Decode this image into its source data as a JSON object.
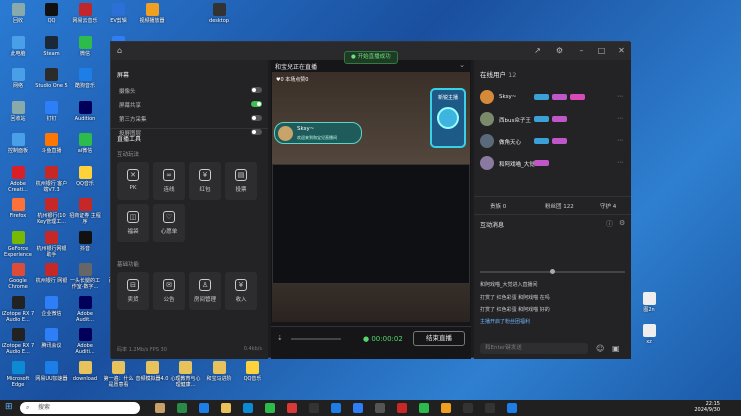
{
  "desktop": {
    "icons": [
      {
        "label": "回收",
        "col": 0,
        "row": 0,
        "color": "#8aa"
      },
      {
        "label": "QQ",
        "col": 1,
        "row": 0,
        "color": "#111"
      },
      {
        "label": "网易云音乐",
        "col": 2,
        "row": 0,
        "color": "#c0272d"
      },
      {
        "label": "EV剪辑",
        "col": 3,
        "row": 0,
        "color": "#2c6fd6"
      },
      {
        "label": "视频播放器",
        "col": 4,
        "row": 0,
        "color": "#f0a020"
      },
      {
        "label": "desktop",
        "col": 6,
        "row": 0,
        "color": "#333"
      },
      {
        "label": "此电脑",
        "col": 0,
        "row": 1,
        "color": "#4aa0e8"
      },
      {
        "label": "Steam",
        "col": 1,
        "row": 1,
        "color": "#1b2838"
      },
      {
        "label": "微信",
        "col": 2,
        "row": 1,
        "color": "#2dbb4c"
      },
      {
        "label": "钉钉",
        "col": 3,
        "row": 1,
        "color": "#2d7ef7"
      },
      {
        "label": "网络",
        "col": 0,
        "row": 2,
        "color": "#4aa0e8"
      },
      {
        "label": "Studio One 5",
        "col": 1,
        "row": 2,
        "color": "#2b2b2b"
      },
      {
        "label": "酷狗音乐",
        "col": 2,
        "row": 2,
        "color": "#1e7ee8"
      },
      {
        "label": "回收站",
        "col": 0,
        "row": 3,
        "color": "#8aa"
      },
      {
        "label": "钉钉",
        "col": 1,
        "row": 3,
        "color": "#2d7ef7"
      },
      {
        "label": "Audition",
        "col": 2,
        "row": 3,
        "color": "#00005b"
      },
      {
        "label": "控制面板",
        "col": 0,
        "row": 4,
        "color": "#4aa0e8"
      },
      {
        "label": "斗鱼直播",
        "col": 1,
        "row": 4,
        "color": "#ff7700"
      },
      {
        "label": "ai微信",
        "col": 2,
        "row": 4,
        "color": "#2dbb4c"
      },
      {
        "label": "Adobe Creati...",
        "col": 0,
        "row": 5,
        "color": "#da1f26"
      },
      {
        "label": "杭州银行 客户端V7.3",
        "col": 1,
        "row": 5,
        "color": "#c62828"
      },
      {
        "label": "QQ音乐",
        "col": 2,
        "row": 5,
        "color": "#ffd23c"
      },
      {
        "label": "WPS",
        "col": 3,
        "row": 5,
        "color": "#c62828"
      },
      {
        "label": "Firefox",
        "col": 0,
        "row": 6,
        "color": "#ff7139"
      },
      {
        "label": "杭州银行(10 Key管理工...",
        "col": 1,
        "row": 6,
        "color": "#c62828"
      },
      {
        "label": "招商证券 主程序",
        "col": 2,
        "row": 6,
        "color": "#c62828"
      },
      {
        "label": "迅雷",
        "col": 3,
        "row": 6,
        "color": "#1e7ee8"
      },
      {
        "label": "GeForce Experience",
        "col": 0,
        "row": 7,
        "color": "#76b900"
      },
      {
        "label": "杭州银行网银助手",
        "col": 1,
        "row": 7,
        "color": "#c62828"
      },
      {
        "label": "抖音",
        "col": 2,
        "row": 7,
        "color": "#111"
      },
      {
        "label": "Google Chrome",
        "col": 0,
        "row": 8,
        "color": "#dd4b39"
      },
      {
        "label": "杭州银行 网银",
        "col": 1,
        "row": 8,
        "color": "#c62828"
      },
      {
        "label": "一头长腿的工作室-数字...",
        "col": 2,
        "row": 8,
        "color": "#666"
      },
      {
        "label": "百度网盘",
        "col": 3,
        "row": 8,
        "color": "#2d7ef7"
      },
      {
        "label": "iZotope RX 7 Audio E...",
        "col": 0,
        "row": 9,
        "color": "#222"
      },
      {
        "label": "企业微信",
        "col": 1,
        "row": 9,
        "color": "#2d7ef7"
      },
      {
        "label": "Adobe Audit...",
        "col": 2,
        "row": 9,
        "color": "#00005b"
      },
      {
        "label": "iZotope RX 7 Audio E...",
        "col": 0,
        "row": 10,
        "color": "#222"
      },
      {
        "label": "腾讯会议",
        "col": 1,
        "row": 10,
        "color": "#2d7ef7"
      },
      {
        "label": "Adobe Auditi...",
        "col": 2,
        "row": 10,
        "color": "#00005b"
      },
      {
        "label": "Microsoft Edge",
        "col": 0,
        "row": 11,
        "color": "#0c8ad4"
      },
      {
        "label": "网易UU加速器",
        "col": 1,
        "row": 11,
        "color": "#1e7ee8"
      },
      {
        "label": "download",
        "col": 2,
        "row": 11,
        "color": "#e8c25a"
      },
      {
        "label": "第一遍：什么是愿意看",
        "col": 3,
        "row": 11,
        "color": "#e8c25a"
      },
      {
        "label": "音频模拟器4.0",
        "col": 4,
        "row": 11,
        "color": "#e8c25a"
      },
      {
        "label": "心理教育与心理健康...",
        "col": 5,
        "row": 11,
        "color": "#e8c25a"
      },
      {
        "label": "和宝马进阶",
        "col": 6,
        "row": 11,
        "color": "#e8c25a"
      },
      {
        "label": "QQ音乐",
        "col": 7,
        "row": 11,
        "color": "#ffd23c"
      }
    ],
    "right_icons": [
      {
        "label": "图2n",
        "row": 0
      },
      {
        "label": "xz",
        "row": 1
      }
    ]
  },
  "app": {
    "badge": "开始直播成功",
    "center_title": "和宝兒正在直播",
    "online_title": "在线用户",
    "online_count": "12",
    "left": {
      "screen_title": "屏幕",
      "toggles": [
        {
          "label": "摄像头",
          "on": false
        },
        {
          "label": "屏幕共享",
          "on": true
        },
        {
          "label": "第三方采集",
          "on": false
        },
        {
          "label": "投屏图层",
          "on": false
        }
      ],
      "tools_title": "直播工具",
      "interact_title": "互动玩法",
      "interact_tiles": [
        {
          "label": "PK",
          "icon": "✕"
        },
        {
          "label": "连线",
          "icon": "∞"
        },
        {
          "label": "红包",
          "icon": "¥"
        },
        {
          "label": "投票",
          "icon": "▤"
        },
        {
          "label": "福袋",
          "icon": "◫"
        },
        {
          "label": "心愿单",
          "icon": "♡"
        }
      ],
      "basic_title": "基础功能",
      "basic_tiles": [
        {
          "label": "卖货",
          "icon": "⊟"
        },
        {
          "label": "公告",
          "icon": "✉"
        },
        {
          "label": "房间管理",
          "icon": "♙"
        },
        {
          "label": "收入",
          "icon": "¥"
        }
      ],
      "status_left": "码率 1.2Mb/s FPS 30",
      "status_right": "0.4kb/s"
    },
    "center": {
      "stats": "♥0 本场点赞0",
      "streamer_name": "Sksy~",
      "streamer_sub": "欢迎来到和宝兒直播间",
      "timer": "00:00:02",
      "end_button": "结束直播",
      "banner": "新锐主播"
    },
    "right": {
      "users": [
        {
          "name": "Sksy~",
          "color": "#d58a3a",
          "tags": [
            "#3aa0d8",
            "#c057c8",
            "#d84ab8"
          ]
        },
        {
          "name": "西bus众子王",
          "color": "#7a8a6a",
          "tags": [
            "#3aa0d8",
            "#c057c8"
          ]
        },
        {
          "name": "做角天心",
          "color": "#5a6a7a",
          "tags": [
            "#3aa0d8",
            "#c057c8"
          ]
        },
        {
          "name": "和阿戏喵_大觉",
          "color": "#8a7aa0",
          "tags": [
            "#c057c8"
          ]
        }
      ],
      "stats": [
        {
          "label": "贵族 0"
        },
        {
          "label": "粉丝团 122"
        },
        {
          "label": "守护 4"
        }
      ],
      "messages_title": "互动消息",
      "system_msg": "和阿戏喵_大觉进入直播间",
      "messages": [
        "打赏了 红色彩蛋 和阿戏喵 在吗",
        "打赏了 红色彩蛋 和阿戏喵 好的",
        "主播开启了粉丝团福利"
      ],
      "input_placeholder": "和Enter键发送"
    }
  },
  "taskbar": {
    "search": "搜索",
    "time": "22:15",
    "date": "2024/9/30"
  }
}
